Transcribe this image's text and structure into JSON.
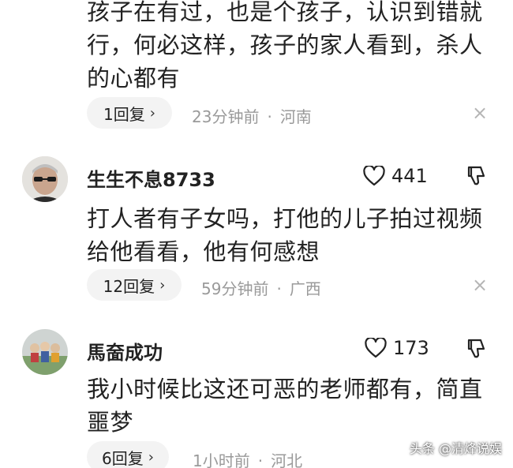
{
  "comments": [
    {
      "text_lines": [
        "孩子在有过，也是个孩子，认识到错就",
        "行，何必这样，孩子的家人看到，杀人",
        "的心都有"
      ],
      "reply_label": "1回复",
      "time": "23分钟前",
      "location": "河南"
    },
    {
      "username": "生生不息8733",
      "likes": "441",
      "text_lines": [
        "打人者有子女吗，打他的儿子拍过视频",
        "给他看看，他有何感想"
      ],
      "reply_label": "12回复",
      "time": "59分钟前",
      "location": "广西"
    },
    {
      "username": "馬奤成功",
      "likes": "173",
      "text_lines": [
        "我小时候比这还可恶的老师都有，简直",
        "噩梦"
      ],
      "reply_label": "6回复",
      "time": "1小时前",
      "location": "河北"
    }
  ],
  "separator": "·",
  "reply_chevron": "›",
  "close_glyph": "×",
  "watermark": "头条 @清烽说娱",
  "colors": {
    "text": "#222222",
    "meta": "#9a9a9a",
    "pill_bg": "#f3f3f3",
    "close": "#b5b5b5"
  },
  "icons": {
    "like": "heart-outline-icon",
    "dislike": "thumb-down-outline-icon",
    "close": "close-icon",
    "chevron": "chevron-right-icon"
  }
}
